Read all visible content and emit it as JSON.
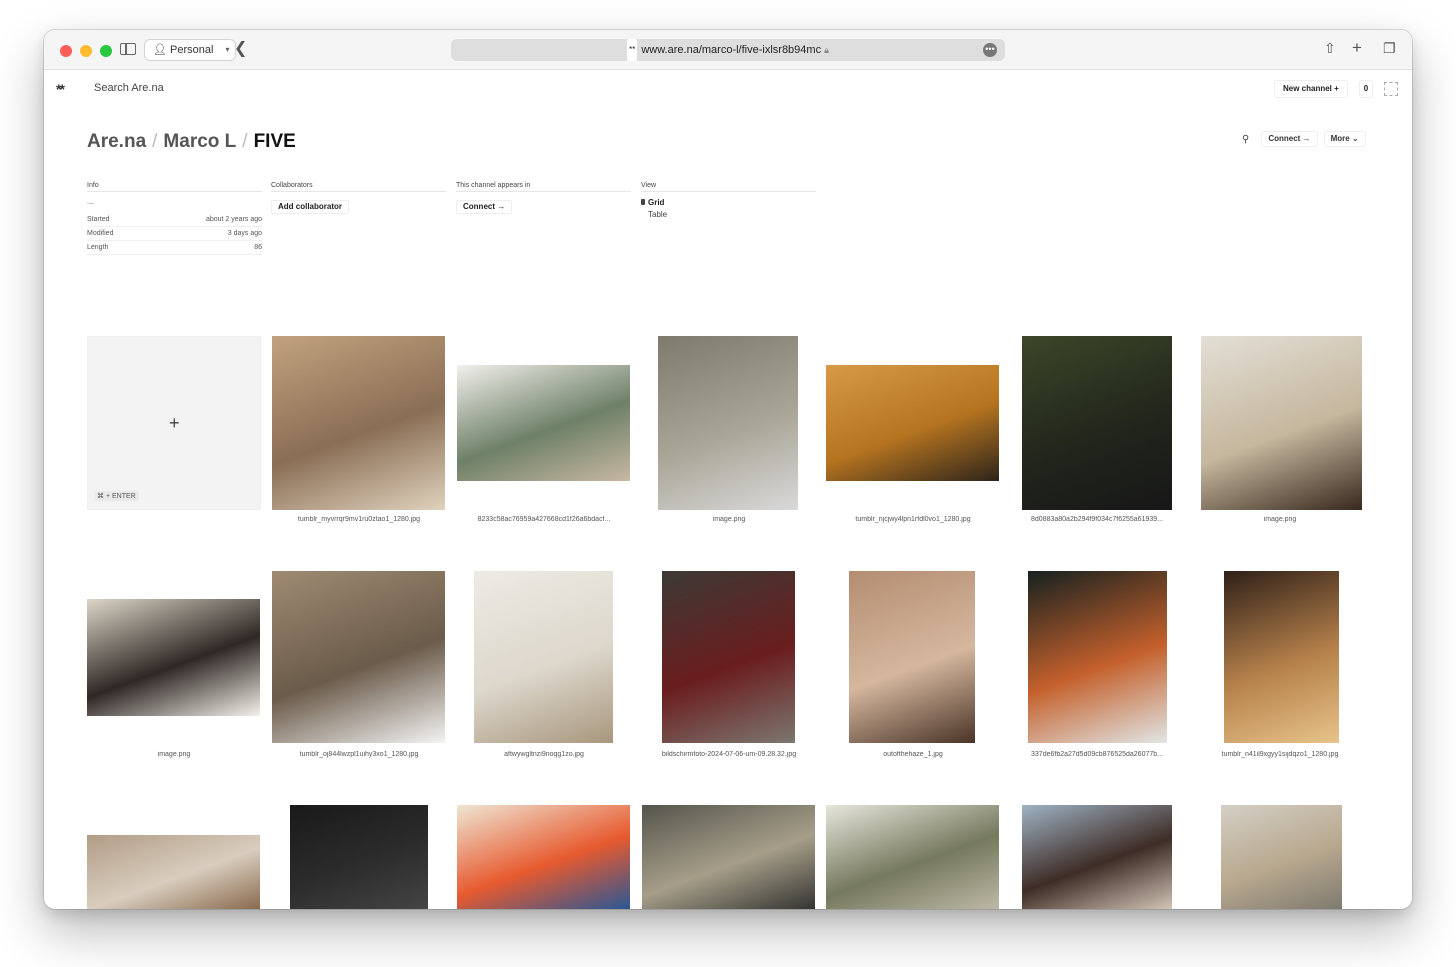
{
  "browser": {
    "profile": "Personal",
    "url": "www.are.na/marco-l/five-ixlsr8b94mc",
    "site_icon": "**",
    "traffic_light_colors": [
      "#ff5f57",
      "#febc2e",
      "#28c840"
    ]
  },
  "header": {
    "logo": "**",
    "search_placeholder": "Search Are.na",
    "new_channel_label": "New channel +",
    "notifications_count": "0"
  },
  "breadcrumb": {
    "root": "Are.na",
    "user": "Marco L",
    "channel": "FIVE"
  },
  "actions": {
    "connect_label": "Connect →",
    "more_label": "More ⌄"
  },
  "info": {
    "info_head": "Info",
    "description": "—",
    "started_label": "Started",
    "started_value": "about 2 years ago",
    "modified_label": "Modified",
    "modified_value": "3 days ago",
    "length_label": "Length",
    "length_value": "86",
    "collaborators_head": "Collaborators",
    "add_collaborator": "Add collaborator",
    "appears_head": "This channel appears in",
    "appears_connect": "Connect →",
    "view_head": "View",
    "view_grid": "Grid",
    "view_table": "Table"
  },
  "grid": {
    "add_shortcut": "⌘ + ENTER",
    "blocks": [
      {
        "caption": "tumblr_myvrrqr9mv1ru0ztao1_1280.jpg",
        "colors": [
          "#c2a27e",
          "#8a6e55",
          "#e0d2bd"
        ]
      },
      {
        "caption": "8233c58ac76959a427668cd1f26a6bdacf...",
        "colors": [
          "#f2f0ec",
          "#6e8068",
          "#c8b8a2"
        ]
      },
      {
        "caption": "image.png",
        "colors": [
          "#7d7a6e",
          "#a9a597",
          "#d9d9d9"
        ]
      },
      {
        "caption": "tumblr_njcjwy4lpn1rfdl0vo1_1280.jpg",
        "colors": [
          "#d79a45",
          "#b57420",
          "#2e241a"
        ]
      },
      {
        "caption": "8d0883a80a2b294f9f034c7f6255a61939...",
        "colors": [
          "#3c4628",
          "#22261c",
          "#171717"
        ]
      },
      {
        "caption": "image.png",
        "colors": [
          "#e3dfd6",
          "#c6b79e",
          "#38281e"
        ]
      },
      {
        "caption": "image.png",
        "colors": [
          "#ddd6c8",
          "#2f2724",
          "#f4f1ea"
        ]
      },
      {
        "caption": "tumblr_oj844lwzpl1uihy3xo1_1280.jpg",
        "colors": [
          "#9f8b73",
          "#6b5b4a",
          "#f4f4f4"
        ]
      },
      {
        "caption": "aftwywgltnzi9noqg1zo.jpg",
        "colors": [
          "#eeebe5",
          "#ddd7cc",
          "#a8977d"
        ]
      },
      {
        "caption": "bildschirmfoto-2024-07-06-um-09.28.32.jpg",
        "colors": [
          "#3c3a36",
          "#6a1d1e",
          "#7c7770"
        ]
      },
      {
        "caption": "outofthehaze_1.jpg",
        "colors": [
          "#b48d71",
          "#d5b79e",
          "#4a3427"
        ]
      },
      {
        "caption": "337de6fb2a27d5d09cb876525da26077b...",
        "colors": [
          "#16211f",
          "#c4602c",
          "#e1e6e6"
        ]
      },
      {
        "caption": "tumblr_n41il9xgyy1sijdqzo1_1280.jpg",
        "colors": [
          "#2f2018",
          "#b6814b",
          "#e7c48a"
        ]
      },
      {
        "caption": "",
        "colors": [
          "#b29c86",
          "#d8cdbe",
          "#8a6a4e"
        ]
      },
      {
        "caption": "",
        "colors": [
          "#191919",
          "#2c2c2c",
          "#444444"
        ]
      },
      {
        "caption": "",
        "colors": [
          "#efe6d5",
          "#e75a2f",
          "#2a5795"
        ]
      },
      {
        "caption": "",
        "colors": [
          "#55544c",
          "#a69e89",
          "#343431"
        ]
      },
      {
        "caption": "",
        "colors": [
          "#e8e6dd",
          "#75795d",
          "#bdb8a6"
        ]
      },
      {
        "caption": "",
        "colors": [
          "#9fb3c4",
          "#3e2c26",
          "#d2c4b6"
        ]
      },
      {
        "caption": "",
        "colors": [
          "#d4cfc5",
          "#b8a88e",
          "#7e7a70"
        ]
      }
    ]
  }
}
